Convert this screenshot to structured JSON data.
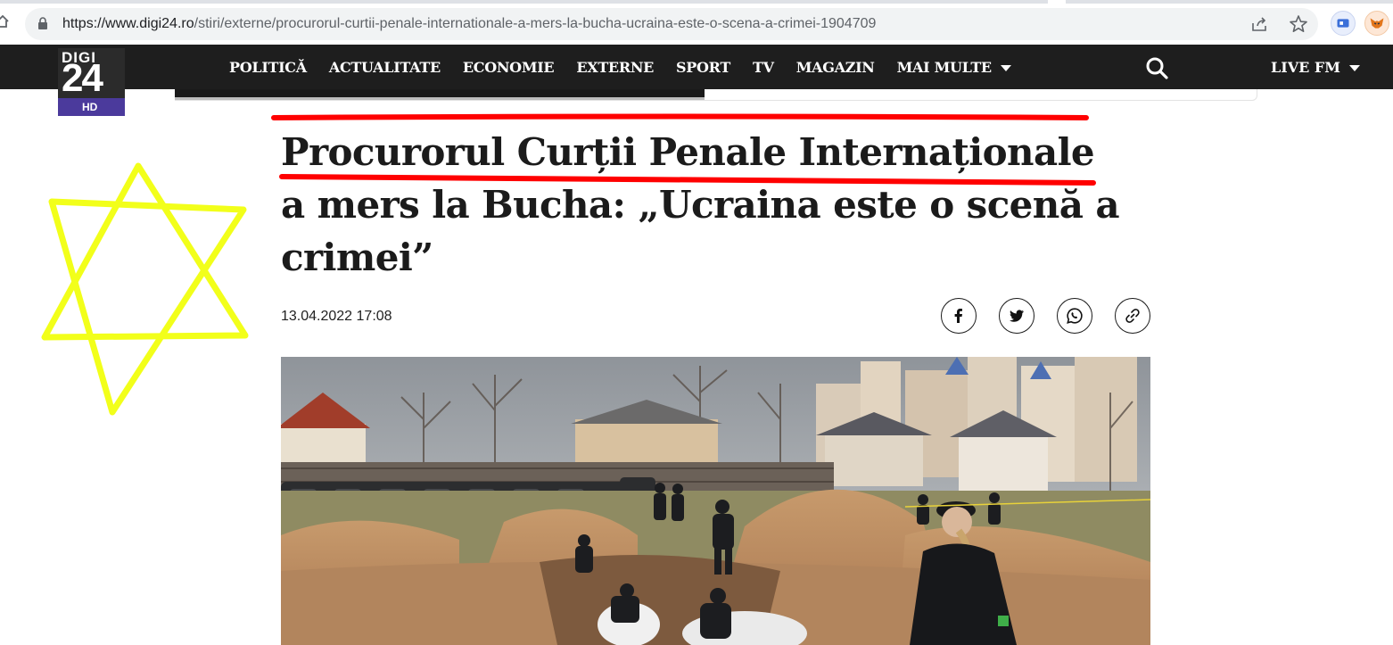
{
  "browser": {
    "url_base": "https://www.digi24.ro",
    "url_path": "/stiri/externe/procurorul-curtii-penale-internationale-a-mers-la-bucha-ucraina-este-o-scena-a-crimei-1904709",
    "icons": [
      "home-icon",
      "lock-icon",
      "share-icon",
      "star-icon",
      "extension-icon",
      "metamask-icon"
    ]
  },
  "logo": {
    "top": "DIGI",
    "number": "24",
    "badge": "HD"
  },
  "nav": {
    "items": [
      "POLITICĂ",
      "ACTUALITATE",
      "ECONOMIE",
      "EXTERNE",
      "SPORT",
      "TV",
      "MAGAZIN",
      "MAI MULTE"
    ],
    "live": "LIVE FM",
    "reading_progress_percent": 49
  },
  "article": {
    "title": "Procurorul Curții Penale Internaționale a mers la Bucha: „Ucraina este o scenă a crimei”",
    "date": "13.04.2022 17:08",
    "share_icons": [
      "facebook-icon",
      "twitter-icon",
      "whatsapp-icon",
      "link-icon"
    ]
  },
  "colors": {
    "nav_bg": "#1e1e1e",
    "logo_hd": "#4b3a9c",
    "annotation_red": "#ff0000",
    "annotation_yellow": "#f2ff1a"
  }
}
